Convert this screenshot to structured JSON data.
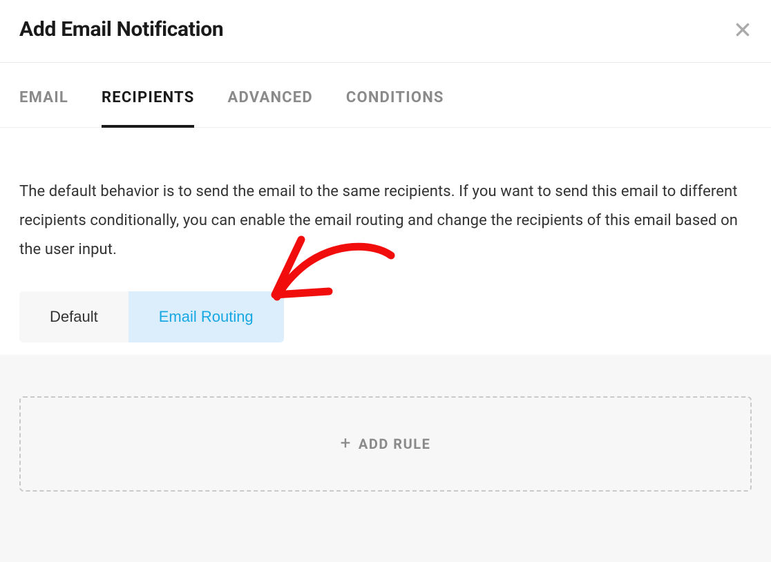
{
  "header": {
    "title": "Add Email Notification"
  },
  "tabs": [
    {
      "label": "EMAIL",
      "active": false
    },
    {
      "label": "RECIPIENTS",
      "active": true
    },
    {
      "label": "ADVANCED",
      "active": false
    },
    {
      "label": "CONDITIONS",
      "active": false
    }
  ],
  "recipients": {
    "description": "The default behavior is to send the email to the same recipients. If you want to send this email to different recipients conditionally, you can enable the email routing and change the recipients of this email based on the user input.",
    "toggle": {
      "default_label": "Default",
      "routing_label": "Email Routing",
      "selected": "routing"
    },
    "add_rule_label": "ADD RULE"
  },
  "annotation": {
    "arrow_color": "#f20d0d"
  }
}
